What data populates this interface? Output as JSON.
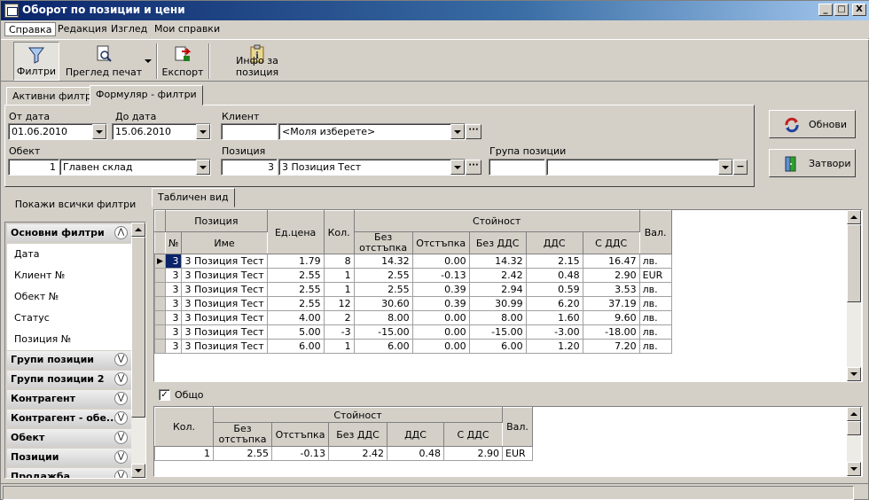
{
  "window": {
    "title": "Оборот по позиции и цени",
    "min": "_",
    "max": "□",
    "close": "X"
  },
  "menu": [
    "Справка",
    "Редакция",
    "Изглед",
    "Мои справки"
  ],
  "toolbar": {
    "filters": "Филтри",
    "print_preview": "Преглед печат",
    "export": "Експорт",
    "position_info": "Инфо за позиция"
  },
  "tabs": {
    "active_filters": "Активни филтри",
    "form_filters": "Формуляр - филтри"
  },
  "form": {
    "from_date_label": "От дата",
    "from_date": "01.06.2010",
    "to_date_label": "До дата",
    "to_date": "15.06.2010",
    "client_label": "Клиент",
    "client_code": "",
    "client_value": "<Моля изберете>",
    "object_label": "Обект",
    "object_code": "1",
    "object_value": "Главен склад",
    "position_label": "Позиция",
    "position_code": "3",
    "position_value": "3 Позиция Тест",
    "group_label": "Група позиции",
    "group_code": "",
    "group_value": ""
  },
  "buttons": {
    "refresh": "Обнови",
    "close": "Затвори"
  },
  "left_panel": {
    "show_all": "Покажи всички филтри",
    "main_group": "Основни филтри",
    "items": [
      "Дата",
      "Клиент №",
      "Обект №",
      "Статус",
      "Позиция №"
    ],
    "groups": [
      "Групи позиции",
      "Групи позиции 2",
      "Контрагент",
      "Контрагент - обе...",
      "Обект",
      "Позиции",
      "Продажба"
    ]
  },
  "grid_tab": "Табличен вид",
  "grid": {
    "h_position": "Позиция",
    "h_no": "№",
    "h_name": "Име",
    "h_unit_price": "Ед.цена",
    "h_qty": "Кол.",
    "h_value": "Стойност",
    "h_no_discount": "Без отстъпка",
    "h_discount": "Отстъпка",
    "h_no_vat": "Без ДДС",
    "h_vat": "ДДС",
    "h_with_vat": "С ДДС",
    "h_currency": "Вал.",
    "rows": [
      {
        "no": "3",
        "name": "3 Позиция Тест",
        "price": "1.79",
        "qty": "8",
        "nodisc": "14.32",
        "disc": "0.00",
        "novat": "14.32",
        "vat": "2.15",
        "withvat": "16.47",
        "cur": "лв."
      },
      {
        "no": "3",
        "name": "3 Позиция Тест",
        "price": "2.55",
        "qty": "1",
        "nodisc": "2.55",
        "disc": "-0.13",
        "novat": "2.42",
        "vat": "0.48",
        "withvat": "2.90",
        "cur": "EUR"
      },
      {
        "no": "3",
        "name": "3 Позиция Тест",
        "price": "2.55",
        "qty": "1",
        "nodisc": "2.55",
        "disc": "0.39",
        "novat": "2.94",
        "vat": "0.59",
        "withvat": "3.53",
        "cur": "лв."
      },
      {
        "no": "3",
        "name": "3 Позиция Тест",
        "price": "2.55",
        "qty": "12",
        "nodisc": "30.60",
        "disc": "0.39",
        "novat": "30.99",
        "vat": "6.20",
        "withvat": "37.19",
        "cur": "лв."
      },
      {
        "no": "3",
        "name": "3 Позиция Тест",
        "price": "4.00",
        "qty": "2",
        "nodisc": "8.00",
        "disc": "0.00",
        "novat": "8.00",
        "vat": "1.60",
        "withvat": "9.60",
        "cur": "лв."
      },
      {
        "no": "3",
        "name": "3 Позиция Тест",
        "price": "5.00",
        "qty": "-3",
        "nodisc": "-15.00",
        "disc": "0.00",
        "novat": "-15.00",
        "vat": "-3.00",
        "withvat": "-18.00",
        "cur": "лв."
      },
      {
        "no": "3",
        "name": "3 Позиция Тест",
        "price": "6.00",
        "qty": "1",
        "nodisc": "6.00",
        "disc": "0.00",
        "novat": "6.00",
        "vat": "1.20",
        "withvat": "7.20",
        "cur": "лв."
      }
    ]
  },
  "totals": {
    "checkbox_label": "Общо",
    "checked": "✓",
    "h_qty": "Кол.",
    "h_value": "Стойност",
    "h_no_discount": "Без отстъпка",
    "h_discount": "Отстъпка",
    "h_no_vat": "Без ДДС",
    "h_vat": "ДДС",
    "h_with_vat": "С ДДС",
    "h_currency": "Вал.",
    "row": {
      "qty": "1",
      "nodisc": "2.55",
      "disc": "-0.13",
      "novat": "2.42",
      "vat": "0.48",
      "withvat": "2.90",
      "cur": "EUR"
    }
  }
}
